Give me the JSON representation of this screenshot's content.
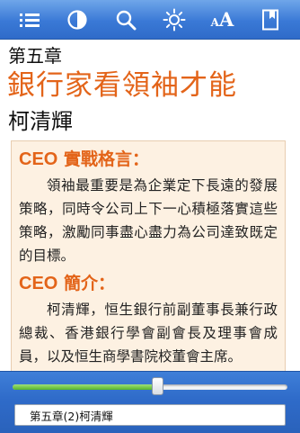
{
  "toolbar": {
    "icons": [
      "list-icon",
      "contrast-icon",
      "search-icon",
      "brightness-icon",
      "font-size-icon",
      "bookmark-icon"
    ],
    "font_size_small": "A",
    "font_size_big": "A"
  },
  "content": {
    "chapter_label": "第五章",
    "chapter_title": "銀行家看領袖才能",
    "author": "柯清輝",
    "sections": [
      {
        "label_prefix": "CEO",
        "label_suffix": "實戰格言：",
        "paragraph": "領袖最重要是為企業定下長遠的發展策略，同時令公司上下一心積極落實這些策略，激勵同事盡心盡力為公司達致既定的目標。"
      },
      {
        "label_prefix": "CEO",
        "label_suffix": "簡介：",
        "paragraph": "柯清輝，恒生銀行前副董事長兼行政總裁、香港銀行學會副會長及理事會成員，以及恒生商學書院校董會主席。"
      }
    ]
  },
  "bottom": {
    "progress": 0.53,
    "chapter_field": "第五章(2)柯清輝"
  },
  "colors": {
    "accent": "#e36419",
    "toolbar": "#3a79d6",
    "box_bg": "#fdf1e2"
  }
}
